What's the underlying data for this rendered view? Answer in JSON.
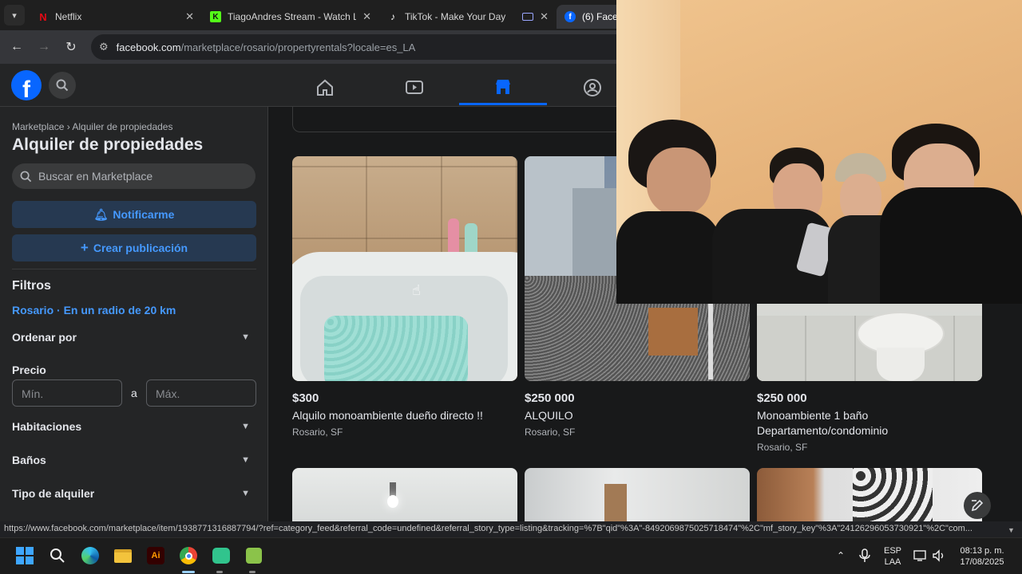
{
  "browser": {
    "tabs": [
      {
        "title": "Netflix",
        "icon": "netflix-icon",
        "active": false
      },
      {
        "title": "TiagoAndres Stream - Watch Li",
        "icon": "kick-icon",
        "active": false
      },
      {
        "title": "TikTok - Make Your Day",
        "icon": "tiktok-icon",
        "active": false
      },
      {
        "title": "(6) Face",
        "icon": "facebook-icon",
        "active": true
      }
    ],
    "url_host": "facebook.com",
    "url_path": "/marketplace/rosario/propertyrentals?locale=es_LA"
  },
  "sidebar": {
    "breadcrumb_root": "Marketplace",
    "breadcrumb_sep": "›",
    "breadcrumb_current": "Alquiler de propiedades",
    "title": "Alquiler de propiedades",
    "search_placeholder": "Buscar en Marketplace",
    "notify_label": "Notificarme",
    "create_label": "Crear publicación",
    "filters_title": "Filtros",
    "location": "Rosario · En un radio de 20 km",
    "sort_label": "Ordenar por",
    "price_label": "Precio",
    "price_min_placeholder": "Mín.",
    "price_sep": "a",
    "price_max_placeholder": "Máx.",
    "rooms_label": "Habitaciones",
    "baths_label": "Baños",
    "rental_type_label": "Tipo de alquiler"
  },
  "listings": [
    {
      "price": "$300",
      "title": "Alquilo monoambiente dueño directo !!",
      "location": "Rosario, SF"
    },
    {
      "price": "$250 000",
      "title": "ALQUILO",
      "location": "Rosario, SF"
    },
    {
      "price": "$250 000",
      "title": "Monoambiente 1 baño Departamento/condominio",
      "location": "Rosario, SF"
    }
  ],
  "status_url": "https://www.facebook.com/marketplace/item/1938771316887794/?ref=category_feed&referral_code=undefined&referral_story_type=listing&tracking=%7B\"qid\"%3A\"-8492069875025718474\"%2C\"mf_story_key\"%3A\"24126296053730921\"%2C\"com...",
  "taskbar": {
    "lang_top": "ESP",
    "lang_bottom": "LAA",
    "time": "08:13 p. m.",
    "date": "17/08/2025"
  },
  "colors": {
    "fb_blue": "#0866ff",
    "link_blue": "#4599ff",
    "button_bg": "#263951"
  }
}
